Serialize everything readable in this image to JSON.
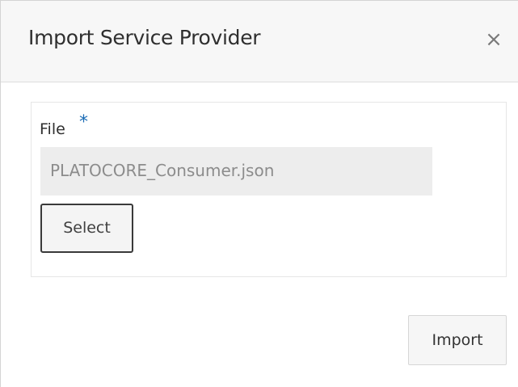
{
  "dialog": {
    "title": "Import Service Provider",
    "close_icon": "close-icon",
    "close_glyph": "×"
  },
  "form": {
    "file_label": "File",
    "required_marker": "*",
    "file_value": "PLATOCORE_Consumer.json",
    "select_label": "Select"
  },
  "footer": {
    "import_label": "Import"
  },
  "colors": {
    "header_bg": "#f7f7f7",
    "field_bg": "#ededed",
    "required_accent": "#1a6bb5"
  }
}
